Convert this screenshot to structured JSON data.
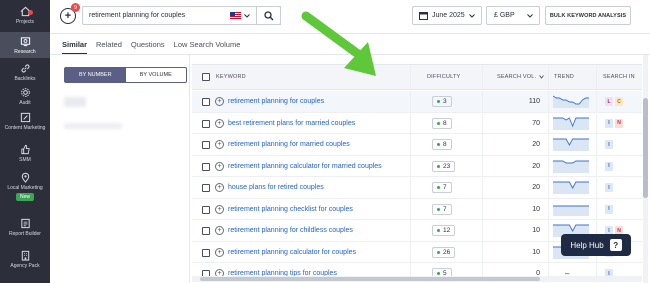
{
  "sidebar": {
    "items": [
      {
        "label": "Projects",
        "icon": "home-icon"
      },
      {
        "label": "Research",
        "icon": "research-icon"
      },
      {
        "label": "Backlinks",
        "icon": "link-icon"
      },
      {
        "label": "Audit",
        "icon": "gear-icon"
      },
      {
        "label": "Content Marketing",
        "icon": "pen-icon"
      },
      {
        "label": "SMM",
        "icon": "thumbs-up-icon"
      },
      {
        "label": "Local Marketing",
        "icon": "map-pin-icon"
      },
      {
        "label": "Report Builder",
        "icon": "report-icon"
      },
      {
        "label": "Agency Pack",
        "icon": "building-icon"
      }
    ],
    "local_badge": "New"
  },
  "topbar": {
    "add_badge": "9",
    "search_value": "retirement planning for couples",
    "date": "June 2025",
    "currency": "£ GBP",
    "bulk_button": "BULK KEYWORD ANALYSIS"
  },
  "tabs": [
    "Similar",
    "Related",
    "Questions",
    "Low Search Volume"
  ],
  "toggle": {
    "by_number": "BY NUMBER",
    "by_volume": "BY VOLUME"
  },
  "table": {
    "headers": {
      "keyword": "KEYWORD",
      "difficulty": "DIFFICULTY",
      "volume": "SEARCH VOL.",
      "trend": "TREND",
      "intent": "SEARCH IN"
    },
    "rows": [
      {
        "keyword": "retirement planning for couples",
        "difficulty": "3",
        "volume": "110",
        "intents": [
          "L",
          "C"
        ],
        "trend": [
          6,
          5,
          5,
          4,
          4,
          3,
          3,
          2,
          2,
          4,
          5,
          5
        ]
      },
      {
        "keyword": "best retirement plans for married couples",
        "difficulty": "8",
        "volume": "70",
        "intents": [
          "I",
          "N"
        ],
        "trend": [
          6,
          6,
          6,
          6,
          5,
          6,
          2,
          6,
          6,
          6,
          6,
          6
        ]
      },
      {
        "keyword": "retirement planning for married couples",
        "difficulty": "8",
        "volume": "20",
        "intents": [
          "I"
        ],
        "trend": [
          6,
          6,
          6,
          6,
          6,
          3,
          6,
          6,
          6,
          6,
          6,
          6
        ]
      },
      {
        "keyword": "retirement planning calculator for married couples",
        "difficulty": "23",
        "volume": "20",
        "intents": [
          "I"
        ],
        "trend": [
          6,
          6,
          6,
          6,
          5,
          5,
          5,
          6,
          6,
          6,
          6,
          6
        ]
      },
      {
        "keyword": "house plans for retired couples",
        "difficulty": "7",
        "volume": "20",
        "intents": [
          "I"
        ],
        "trend": [
          6,
          6,
          6,
          6,
          6,
          6,
          3,
          6,
          6,
          6,
          6,
          6
        ]
      },
      {
        "keyword": "retirement planning checklist for couples",
        "difficulty": "7",
        "volume": "10",
        "intents": [
          "I"
        ],
        "trend": [
          5,
          5,
          5,
          5,
          5,
          5,
          5,
          5,
          5,
          5,
          5,
          5
        ]
      },
      {
        "keyword": "retirement planning for childless couples",
        "difficulty": "12",
        "volume": "10",
        "intents": [
          "I",
          "N"
        ],
        "trend": [
          6,
          6,
          6,
          6,
          6,
          6,
          3,
          6,
          6,
          6,
          6,
          6
        ]
      },
      {
        "keyword": "retirement planning calculator for couples",
        "difficulty": "26",
        "volume": "10",
        "intents": [
          "I"
        ],
        "trend": [
          6,
          6,
          6,
          6,
          6,
          6,
          3,
          6,
          6,
          6,
          6,
          6
        ]
      },
      {
        "keyword": "retirement planning tips for couples",
        "difficulty": "5",
        "volume": "0",
        "intents": [
          "I"
        ],
        "trend": null,
        "trend_text": "–"
      }
    ]
  },
  "help_hub": {
    "label": "Help Hub"
  },
  "colors": {
    "sidebar": "#2c2f3a",
    "link": "#2563c9",
    "arrow": "#5fc83a",
    "easy": "#3aa757",
    "help": "#1f2a44"
  }
}
